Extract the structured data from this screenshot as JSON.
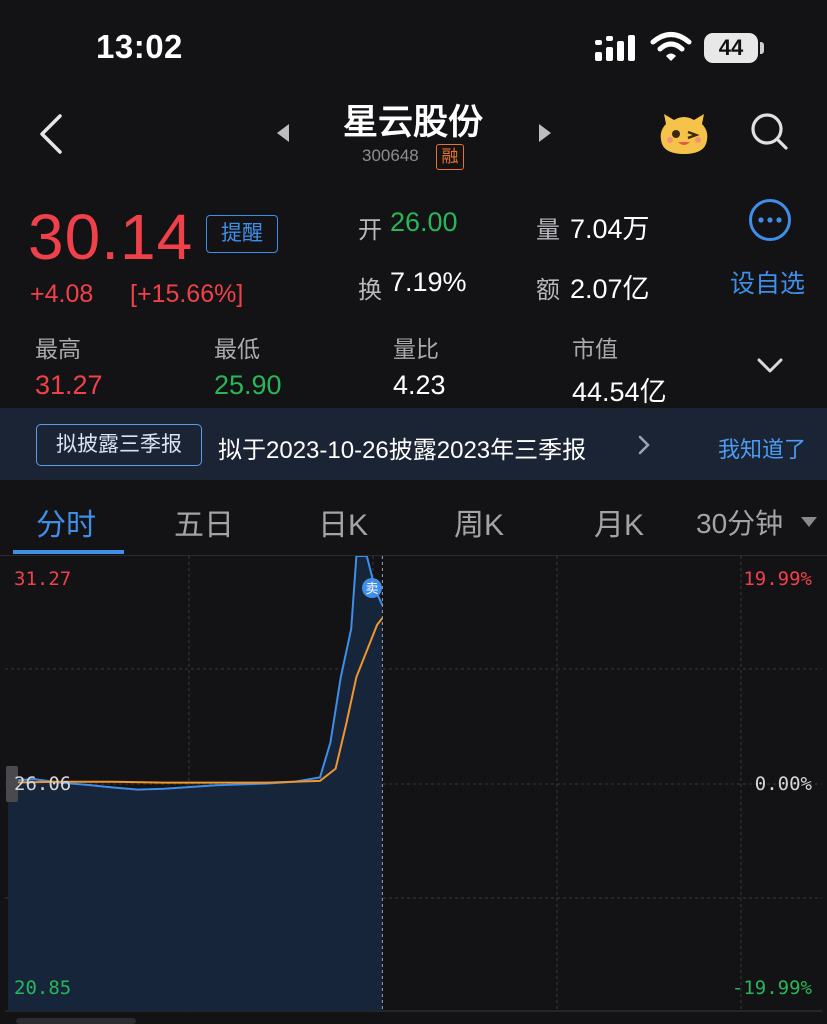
{
  "status_bar": {
    "time": "13:02",
    "battery": "44"
  },
  "header": {
    "name": "星云股份",
    "code": "300648",
    "margin_badge": "融"
  },
  "quote": {
    "price": "30.14",
    "remind_label": "提醒",
    "change": "+4.08",
    "change_pct": "[+15.66%]",
    "open_label": "开",
    "open": "26.00",
    "volume_label": "量",
    "volume": "7.04万",
    "turnover_label": "换",
    "turnover": "7.19%",
    "amount_label": "额",
    "amount": "2.07亿",
    "add_watch": "设自选"
  },
  "stats": [
    {
      "label": "最高",
      "value": "31.27",
      "color": "#f0414a"
    },
    {
      "label": "最低",
      "value": "25.90",
      "color": "#29b659"
    },
    {
      "label": "量比",
      "value": "4.23",
      "color": "#ffffff"
    },
    {
      "label": "市值",
      "value": "44.54亿",
      "color": "#ffffff"
    }
  ],
  "banner": {
    "tag": "拟披露三季报",
    "text": "拟于2023-10-26披露2023年三季报",
    "ack": "我知道了"
  },
  "tabs": [
    "分时",
    "五日",
    "日K",
    "周K",
    "月K",
    "30分钟"
  ],
  "active_tab": "分时",
  "chart": {
    "y_max": "31.27",
    "y_mid": "26.06",
    "y_min": "20.85",
    "pct_max": "19.99%",
    "pct_mid": "0.00%",
    "pct_min": "-19.99%",
    "sell_marker": "卖"
  },
  "chart_data": {
    "type": "line",
    "ylim": [
      20.85,
      31.27
    ],
    "series": [
      {
        "color": "#3f8ee8",
        "x": [
          0,
          5,
          10,
          15,
          20,
          25,
          30,
          35,
          40,
          45,
          50,
          55,
          60,
          62,
          64,
          66,
          67,
          68,
          69,
          70,
          71,
          72
        ],
        "y": [
          26.12,
          26.16,
          26.08,
          26.03,
          25.97,
          25.92,
          25.94,
          25.98,
          26.02,
          26.04,
          26.06,
          26.1,
          26.2,
          27.0,
          28.5,
          29.6,
          31.27,
          31.27,
          31.27,
          30.8,
          30.4,
          30.14
        ]
      },
      {
        "color": "#f0962d",
        "x": [
          0,
          10,
          20,
          30,
          40,
          50,
          60,
          63,
          65,
          67,
          69,
          71,
          72
        ],
        "y": [
          26.08,
          26.1,
          26.1,
          26.08,
          26.08,
          26.08,
          26.12,
          26.4,
          27.4,
          28.5,
          29.1,
          29.7,
          29.85
        ]
      }
    ]
  }
}
